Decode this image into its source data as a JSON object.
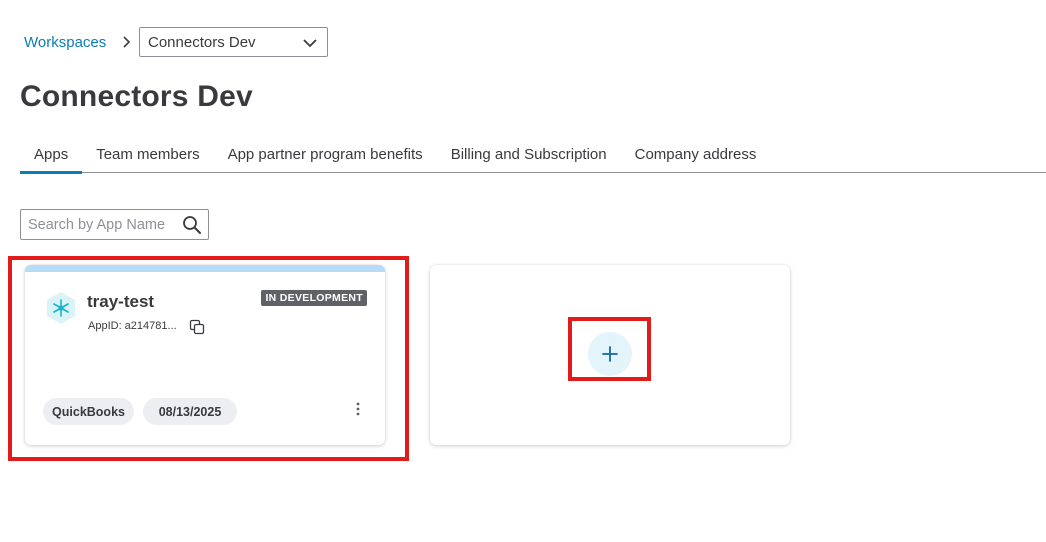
{
  "breadcrumb": {
    "root_label": "Workspaces",
    "current_value": "Connectors Dev"
  },
  "page": {
    "title": "Connectors Dev"
  },
  "tabs": [
    {
      "label": "Apps",
      "active": true
    },
    {
      "label": "Team members",
      "active": false
    },
    {
      "label": "App partner program benefits",
      "active": false
    },
    {
      "label": "Billing and Subscription",
      "active": false
    },
    {
      "label": "Company address",
      "active": false
    }
  ],
  "search": {
    "placeholder": "Search by App Name",
    "value": ""
  },
  "apps": [
    {
      "name": "tray-test",
      "app_id": "AppID: a214781...",
      "status": "IN DEVELOPMENT",
      "integration": "QuickBooks",
      "date": "08/13/2025"
    }
  ],
  "icons": {
    "separator": "chevron-right-icon",
    "dropdown": "chevron-down-icon",
    "search": "search-icon",
    "copy": "copy-icon",
    "menu": "kebab-menu-icon",
    "add": "plus-icon",
    "logo": "app-logo-icon"
  },
  "colors": {
    "link": "#0d7eb3",
    "tab_active": "#0d7eb3",
    "badge_bg": "#5f6166",
    "card_topbar": "#b7dcf7",
    "add_circle": "#e3f4fb",
    "highlight": "#e21b1b",
    "logo": "#1ab3c9"
  }
}
